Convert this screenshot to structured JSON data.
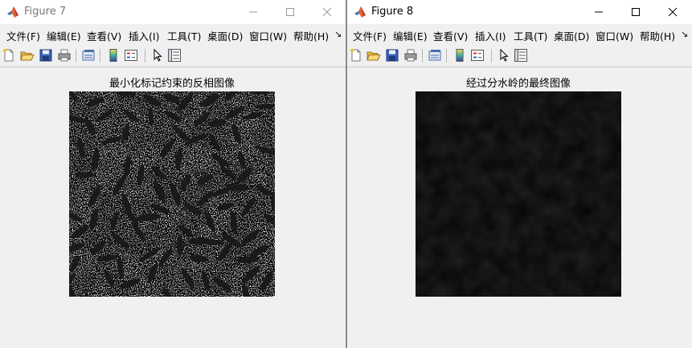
{
  "windows": [
    {
      "title": "Figure 7",
      "menu": [
        "文件(F)",
        "编辑(E)",
        "查看(V)",
        "插入(I)",
        "工具(T)",
        "桌面(D)",
        "窗口(W)",
        "帮助(H)"
      ],
      "overflow_symbol": "↘",
      "axes_title": "最小化标记约束的反相图像"
    },
    {
      "title": "Figure 8",
      "menu": [
        "文件(F)",
        "编辑(E)",
        "查看(V)",
        "插入(I)",
        "工具(T)",
        "桌面(D)",
        "窗口(W)",
        "帮助(H)"
      ],
      "overflow_symbol": "↘",
      "axes_title": "经过分水岭的最终图像"
    }
  ],
  "toolbar_icons": [
    "new-figure-icon",
    "open-file-icon",
    "save-icon",
    "print-icon",
    "link-plot-icon",
    "colorbar-icon",
    "legend-icon",
    "pointer-icon",
    "property-inspector-icon"
  ],
  "colors": {
    "titlebar": "#ffffff",
    "figure_background": "#f0f0f0",
    "grain": "#1a1a1a",
    "final_image": "#040404"
  }
}
